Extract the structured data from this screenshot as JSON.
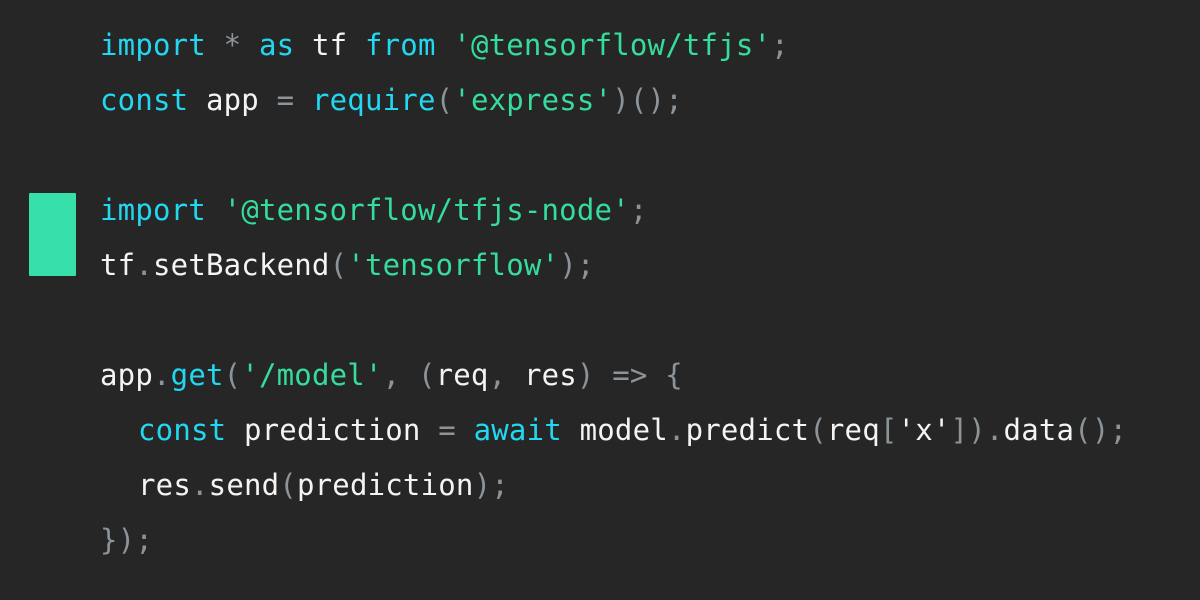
{
  "window": {
    "background_color": "#262626",
    "kind": "code-snippet-image"
  },
  "marker": {
    "name": "line-highlight-marker",
    "color": "#37e0ab",
    "covers_lines": [
      4,
      5
    ]
  },
  "theme": {
    "keyword_color": "#22d7f0",
    "string_color": "#35dd9d",
    "plain_color": "#f4f4f4",
    "punctuation_color": "#8d9499",
    "function_color": "#22d7f0"
  },
  "code": {
    "language": "javascript",
    "lines": [
      {
        "number": 1,
        "indent": 0,
        "text": "import * as tf from '@tensorflow/tfjs';",
        "tokens": [
          {
            "t": "import",
            "c": "kw"
          },
          {
            "t": " ",
            "c": "plain"
          },
          {
            "t": "*",
            "c": "punc"
          },
          {
            "t": " ",
            "c": "plain"
          },
          {
            "t": "as",
            "c": "kw"
          },
          {
            "t": " ",
            "c": "plain"
          },
          {
            "t": "tf",
            "c": "plain"
          },
          {
            "t": " ",
            "c": "plain"
          },
          {
            "t": "from",
            "c": "kw"
          },
          {
            "t": " ",
            "c": "plain"
          },
          {
            "t": "'@tensorflow/tfjs'",
            "c": "str"
          },
          {
            "t": ";",
            "c": "punc"
          }
        ]
      },
      {
        "number": 2,
        "indent": 0,
        "text": "const app = require('express')();",
        "tokens": [
          {
            "t": "const",
            "c": "kw"
          },
          {
            "t": " ",
            "c": "plain"
          },
          {
            "t": "app",
            "c": "plain"
          },
          {
            "t": " ",
            "c": "plain"
          },
          {
            "t": "=",
            "c": "punc"
          },
          {
            "t": " ",
            "c": "plain"
          },
          {
            "t": "require",
            "c": "fn"
          },
          {
            "t": "(",
            "c": "punc"
          },
          {
            "t": "'express'",
            "c": "str"
          },
          {
            "t": ")()",
            "c": "punc"
          },
          {
            "t": ";",
            "c": "punc"
          }
        ]
      },
      {
        "number": 3,
        "indent": 0,
        "text": "",
        "tokens": []
      },
      {
        "number": 4,
        "indent": 0,
        "text": "import '@tensorflow/tfjs-node';",
        "tokens": [
          {
            "t": "import",
            "c": "kw"
          },
          {
            "t": " ",
            "c": "plain"
          },
          {
            "t": "'@tensorflow/tfjs-node'",
            "c": "str"
          },
          {
            "t": ";",
            "c": "punc"
          }
        ]
      },
      {
        "number": 5,
        "indent": 0,
        "text": "tf.setBackend('tensorflow');",
        "tokens": [
          {
            "t": "tf",
            "c": "plain"
          },
          {
            "t": ".",
            "c": "punc"
          },
          {
            "t": "setBackend",
            "c": "plain"
          },
          {
            "t": "(",
            "c": "punc"
          },
          {
            "t": "'tensorflow'",
            "c": "str"
          },
          {
            "t": ")",
            "c": "punc"
          },
          {
            "t": ";",
            "c": "punc"
          }
        ]
      },
      {
        "number": 6,
        "indent": 0,
        "text": "",
        "tokens": []
      },
      {
        "number": 7,
        "indent": 0,
        "text": "app.get('/model', (req, res) => {",
        "tokens": [
          {
            "t": "app",
            "c": "plain"
          },
          {
            "t": ".",
            "c": "punc"
          },
          {
            "t": "get",
            "c": "fn"
          },
          {
            "t": "(",
            "c": "punc"
          },
          {
            "t": "'/model'",
            "c": "str"
          },
          {
            "t": ",",
            "c": "punc"
          },
          {
            "t": " ",
            "c": "plain"
          },
          {
            "t": "(",
            "c": "punc"
          },
          {
            "t": "req",
            "c": "plain"
          },
          {
            "t": ",",
            "c": "punc"
          },
          {
            "t": " ",
            "c": "plain"
          },
          {
            "t": "res",
            "c": "plain"
          },
          {
            "t": ")",
            "c": "punc"
          },
          {
            "t": " ",
            "c": "plain"
          },
          {
            "t": "=>",
            "c": "punc"
          },
          {
            "t": " ",
            "c": "plain"
          },
          {
            "t": "{",
            "c": "punc"
          }
        ]
      },
      {
        "number": 8,
        "indent": 1,
        "text": "const prediction = await model.predict(req['x']).data();",
        "tokens": [
          {
            "t": "const",
            "c": "kw"
          },
          {
            "t": " ",
            "c": "plain"
          },
          {
            "t": "prediction",
            "c": "plain"
          },
          {
            "t": " ",
            "c": "plain"
          },
          {
            "t": "=",
            "c": "punc"
          },
          {
            "t": " ",
            "c": "plain"
          },
          {
            "t": "await",
            "c": "kw"
          },
          {
            "t": " ",
            "c": "plain"
          },
          {
            "t": "model",
            "c": "plain"
          },
          {
            "t": ".",
            "c": "punc"
          },
          {
            "t": "predict",
            "c": "plain"
          },
          {
            "t": "(",
            "c": "punc"
          },
          {
            "t": "req",
            "c": "plain"
          },
          {
            "t": "[",
            "c": "punc"
          },
          {
            "t": "'x'",
            "c": "plain"
          },
          {
            "t": "]",
            "c": "punc"
          },
          {
            "t": ")",
            "c": "punc"
          },
          {
            "t": ".",
            "c": "punc"
          },
          {
            "t": "data",
            "c": "plain"
          },
          {
            "t": "()",
            "c": "punc"
          },
          {
            "t": ";",
            "c": "punc"
          }
        ]
      },
      {
        "number": 9,
        "indent": 1,
        "text": "res.send(prediction);",
        "tokens": [
          {
            "t": "res",
            "c": "plain"
          },
          {
            "t": ".",
            "c": "punc"
          },
          {
            "t": "send",
            "c": "plain"
          },
          {
            "t": "(",
            "c": "punc"
          },
          {
            "t": "prediction",
            "c": "plain"
          },
          {
            "t": ")",
            "c": "punc"
          },
          {
            "t": ";",
            "c": "punc"
          }
        ]
      },
      {
        "number": 10,
        "indent": 0,
        "text": "});",
        "tokens": [
          {
            "t": "});",
            "c": "punc"
          }
        ]
      }
    ]
  }
}
